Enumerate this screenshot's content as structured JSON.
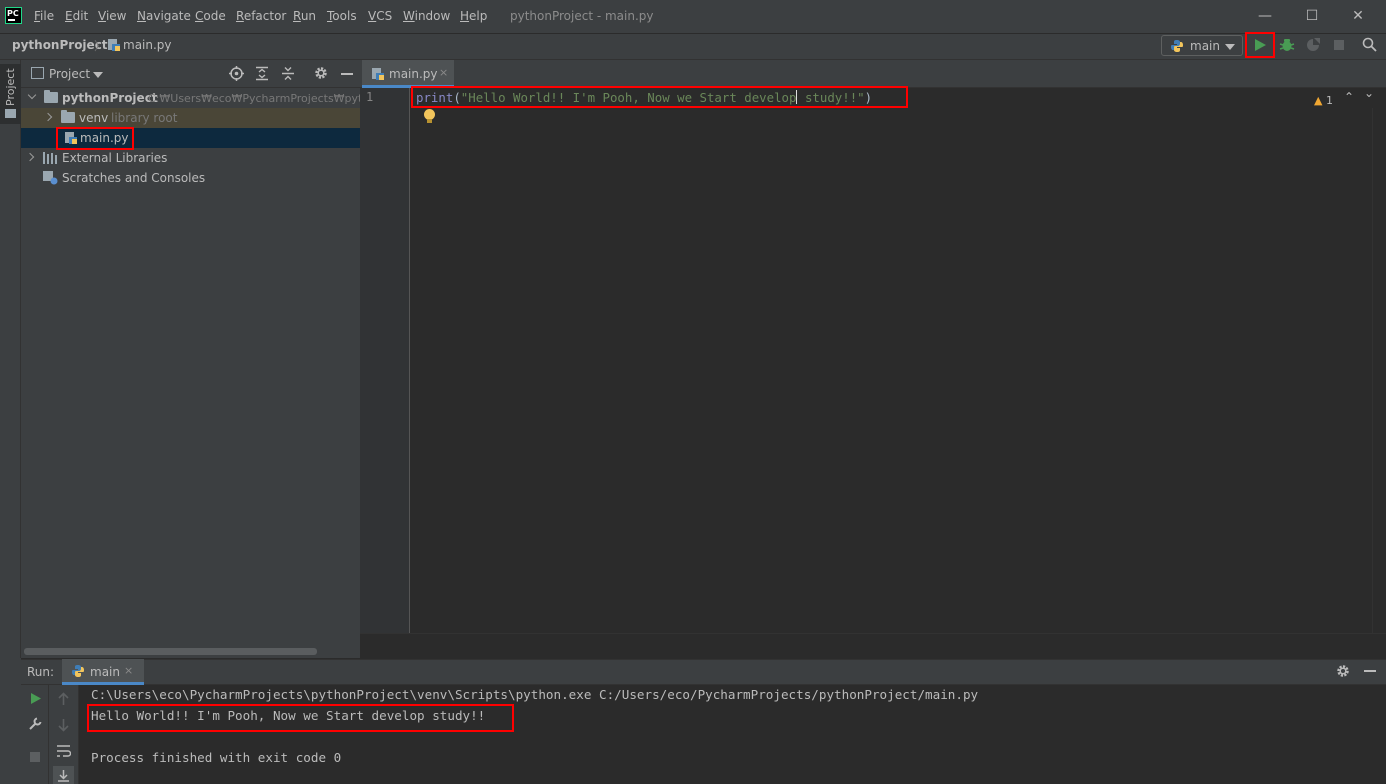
{
  "menubar": {
    "logo_text": "PC",
    "items": [
      {
        "label": "File",
        "mnemonic": "F",
        "rest": "ile"
      },
      {
        "label": "Edit",
        "mnemonic": "E",
        "rest": "dit"
      },
      {
        "label": "View",
        "mnemonic": "V",
        "rest": "iew"
      },
      {
        "label": "Navigate",
        "mnemonic": "N",
        "rest": "avigate"
      },
      {
        "label": "Code",
        "mnemonic": "C",
        "rest": "ode"
      },
      {
        "label": "Refactor",
        "mnemonic": "R",
        "rest": "efactor"
      },
      {
        "label": "Run",
        "mnemonic": "R",
        "rest": "un"
      },
      {
        "label": "Tools",
        "mnemonic": "T",
        "rest": "ools"
      },
      {
        "label": "VCS",
        "mnemonic": "V",
        "rest": "CS"
      },
      {
        "label": "Window",
        "mnemonic": "W",
        "rest": "indow"
      },
      {
        "label": "Help",
        "mnemonic": "H",
        "rest": "elp"
      }
    ],
    "window_title": "pythonProject - main.py",
    "controls": {
      "minimize": "—",
      "maximize": "☐",
      "close": "✕"
    }
  },
  "navbar": {
    "breadcrumb_root": "pythonProject",
    "breadcrumb_sep": "〉",
    "breadcrumb_file": "main.py",
    "run_config": "main"
  },
  "left_stripe": {
    "tab_label": "Project"
  },
  "project_panel": {
    "title": "Project",
    "tree": {
      "root": {
        "name": "pythonProject",
        "path": "C:₩Users₩eco₩PycharmProjects₩pytho"
      },
      "venv": {
        "name": "venv",
        "note": "library root"
      },
      "file": {
        "name": "main.py"
      },
      "external": {
        "name": "External Libraries"
      },
      "scratches": {
        "name": "Scratches and Consoles"
      }
    }
  },
  "editor": {
    "tab_label": "main.py",
    "tab_close": "×",
    "line_number": "1",
    "code": {
      "func": "print",
      "open": "(",
      "string_before_caret": "\"Hello World!! I'm Pooh, Now we Start develop",
      "string_after_caret": " study!!\"",
      "close": ")"
    },
    "inspection": {
      "warning_icon": "▲",
      "count": "1",
      "up": "⌃",
      "down": "⌄"
    }
  },
  "run_panel": {
    "label": "Run:",
    "tab_label": "main",
    "tab_close": "×",
    "console": {
      "command": "C:\\Users\\eco\\PycharmProjects\\pythonProject\\venv\\Scripts\\python.exe C:/Users/eco/PycharmProjects/pythonProject/main.py",
      "output": "Hello World!! I'm Pooh, Now we Start develop study!!",
      "exit": "Process finished with exit code 0"
    }
  },
  "colors": {
    "run_green": "#499c54",
    "highlight_red": "#ff0000",
    "accent_blue": "#4a88c7",
    "selection": "#0d293e"
  }
}
